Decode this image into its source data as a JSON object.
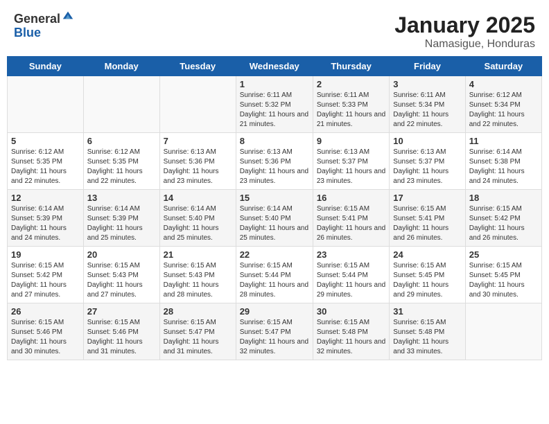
{
  "header": {
    "logo_general": "General",
    "logo_blue": "Blue",
    "month_title": "January 2025",
    "location": "Namasigue, Honduras"
  },
  "days_of_week": [
    "Sunday",
    "Monday",
    "Tuesday",
    "Wednesday",
    "Thursday",
    "Friday",
    "Saturday"
  ],
  "weeks": [
    [
      {
        "day": "",
        "sunrise": "",
        "sunset": "",
        "daylight": ""
      },
      {
        "day": "",
        "sunrise": "",
        "sunset": "",
        "daylight": ""
      },
      {
        "day": "",
        "sunrise": "",
        "sunset": "",
        "daylight": ""
      },
      {
        "day": "1",
        "sunrise": "Sunrise: 6:11 AM",
        "sunset": "Sunset: 5:32 PM",
        "daylight": "Daylight: 11 hours and 21 minutes."
      },
      {
        "day": "2",
        "sunrise": "Sunrise: 6:11 AM",
        "sunset": "Sunset: 5:33 PM",
        "daylight": "Daylight: 11 hours and 21 minutes."
      },
      {
        "day": "3",
        "sunrise": "Sunrise: 6:11 AM",
        "sunset": "Sunset: 5:34 PM",
        "daylight": "Daylight: 11 hours and 22 minutes."
      },
      {
        "day": "4",
        "sunrise": "Sunrise: 6:12 AM",
        "sunset": "Sunset: 5:34 PM",
        "daylight": "Daylight: 11 hours and 22 minutes."
      }
    ],
    [
      {
        "day": "5",
        "sunrise": "Sunrise: 6:12 AM",
        "sunset": "Sunset: 5:35 PM",
        "daylight": "Daylight: 11 hours and 22 minutes."
      },
      {
        "day": "6",
        "sunrise": "Sunrise: 6:12 AM",
        "sunset": "Sunset: 5:35 PM",
        "daylight": "Daylight: 11 hours and 22 minutes."
      },
      {
        "day": "7",
        "sunrise": "Sunrise: 6:13 AM",
        "sunset": "Sunset: 5:36 PM",
        "daylight": "Daylight: 11 hours and 23 minutes."
      },
      {
        "day": "8",
        "sunrise": "Sunrise: 6:13 AM",
        "sunset": "Sunset: 5:36 PM",
        "daylight": "Daylight: 11 hours and 23 minutes."
      },
      {
        "day": "9",
        "sunrise": "Sunrise: 6:13 AM",
        "sunset": "Sunset: 5:37 PM",
        "daylight": "Daylight: 11 hours and 23 minutes."
      },
      {
        "day": "10",
        "sunrise": "Sunrise: 6:13 AM",
        "sunset": "Sunset: 5:37 PM",
        "daylight": "Daylight: 11 hours and 23 minutes."
      },
      {
        "day": "11",
        "sunrise": "Sunrise: 6:14 AM",
        "sunset": "Sunset: 5:38 PM",
        "daylight": "Daylight: 11 hours and 24 minutes."
      }
    ],
    [
      {
        "day": "12",
        "sunrise": "Sunrise: 6:14 AM",
        "sunset": "Sunset: 5:39 PM",
        "daylight": "Daylight: 11 hours and 24 minutes."
      },
      {
        "day": "13",
        "sunrise": "Sunrise: 6:14 AM",
        "sunset": "Sunset: 5:39 PM",
        "daylight": "Daylight: 11 hours and 25 minutes."
      },
      {
        "day": "14",
        "sunrise": "Sunrise: 6:14 AM",
        "sunset": "Sunset: 5:40 PM",
        "daylight": "Daylight: 11 hours and 25 minutes."
      },
      {
        "day": "15",
        "sunrise": "Sunrise: 6:14 AM",
        "sunset": "Sunset: 5:40 PM",
        "daylight": "Daylight: 11 hours and 25 minutes."
      },
      {
        "day": "16",
        "sunrise": "Sunrise: 6:15 AM",
        "sunset": "Sunset: 5:41 PM",
        "daylight": "Daylight: 11 hours and 26 minutes."
      },
      {
        "day": "17",
        "sunrise": "Sunrise: 6:15 AM",
        "sunset": "Sunset: 5:41 PM",
        "daylight": "Daylight: 11 hours and 26 minutes."
      },
      {
        "day": "18",
        "sunrise": "Sunrise: 6:15 AM",
        "sunset": "Sunset: 5:42 PM",
        "daylight": "Daylight: 11 hours and 26 minutes."
      }
    ],
    [
      {
        "day": "19",
        "sunrise": "Sunrise: 6:15 AM",
        "sunset": "Sunset: 5:42 PM",
        "daylight": "Daylight: 11 hours and 27 minutes."
      },
      {
        "day": "20",
        "sunrise": "Sunrise: 6:15 AM",
        "sunset": "Sunset: 5:43 PM",
        "daylight": "Daylight: 11 hours and 27 minutes."
      },
      {
        "day": "21",
        "sunrise": "Sunrise: 6:15 AM",
        "sunset": "Sunset: 5:43 PM",
        "daylight": "Daylight: 11 hours and 28 minutes."
      },
      {
        "day": "22",
        "sunrise": "Sunrise: 6:15 AM",
        "sunset": "Sunset: 5:44 PM",
        "daylight": "Daylight: 11 hours and 28 minutes."
      },
      {
        "day": "23",
        "sunrise": "Sunrise: 6:15 AM",
        "sunset": "Sunset: 5:44 PM",
        "daylight": "Daylight: 11 hours and 29 minutes."
      },
      {
        "day": "24",
        "sunrise": "Sunrise: 6:15 AM",
        "sunset": "Sunset: 5:45 PM",
        "daylight": "Daylight: 11 hours and 29 minutes."
      },
      {
        "day": "25",
        "sunrise": "Sunrise: 6:15 AM",
        "sunset": "Sunset: 5:45 PM",
        "daylight": "Daylight: 11 hours and 30 minutes."
      }
    ],
    [
      {
        "day": "26",
        "sunrise": "Sunrise: 6:15 AM",
        "sunset": "Sunset: 5:46 PM",
        "daylight": "Daylight: 11 hours and 30 minutes."
      },
      {
        "day": "27",
        "sunrise": "Sunrise: 6:15 AM",
        "sunset": "Sunset: 5:46 PM",
        "daylight": "Daylight: 11 hours and 31 minutes."
      },
      {
        "day": "28",
        "sunrise": "Sunrise: 6:15 AM",
        "sunset": "Sunset: 5:47 PM",
        "daylight": "Daylight: 11 hours and 31 minutes."
      },
      {
        "day": "29",
        "sunrise": "Sunrise: 6:15 AM",
        "sunset": "Sunset: 5:47 PM",
        "daylight": "Daylight: 11 hours and 32 minutes."
      },
      {
        "day": "30",
        "sunrise": "Sunrise: 6:15 AM",
        "sunset": "Sunset: 5:48 PM",
        "daylight": "Daylight: 11 hours and 32 minutes."
      },
      {
        "day": "31",
        "sunrise": "Sunrise: 6:15 AM",
        "sunset": "Sunset: 5:48 PM",
        "daylight": "Daylight: 11 hours and 33 minutes."
      },
      {
        "day": "",
        "sunrise": "",
        "sunset": "",
        "daylight": ""
      }
    ]
  ]
}
